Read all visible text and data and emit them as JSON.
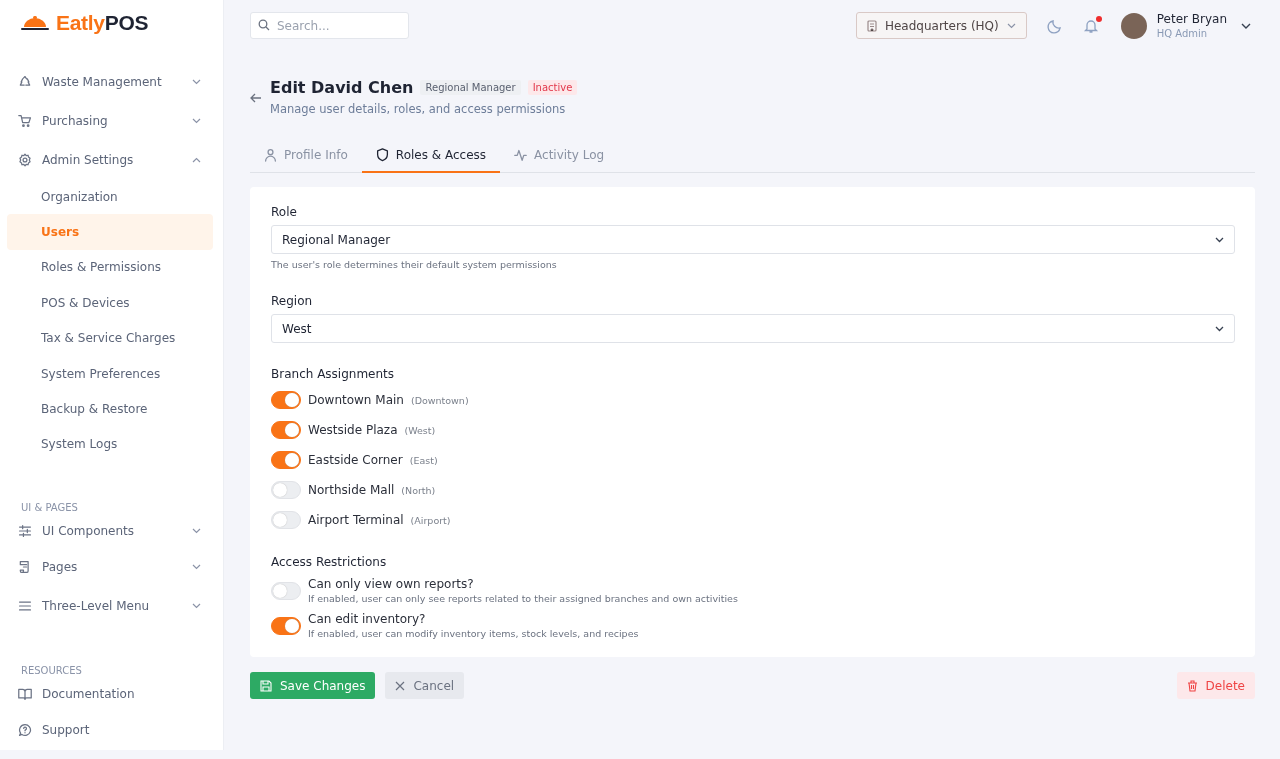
{
  "brand": {
    "name_a": "Eatly",
    "name_b": "POS"
  },
  "sidebar": {
    "items": [
      {
        "label": "Waste Management",
        "expanded": false
      },
      {
        "label": "Purchasing",
        "expanded": false
      },
      {
        "label": "Admin Settings",
        "expanded": true,
        "children": [
          {
            "label": "Organization",
            "selected": false
          },
          {
            "label": "Users",
            "selected": true
          },
          {
            "label": "Roles & Permissions",
            "selected": false
          },
          {
            "label": "POS & Devices",
            "selected": false
          },
          {
            "label": "Tax & Service Charges",
            "selected": false
          },
          {
            "label": "System Preferences",
            "selected": false
          },
          {
            "label": "Backup & Restore",
            "selected": false
          },
          {
            "label": "System Logs",
            "selected": false
          }
        ]
      }
    ],
    "sections": [
      {
        "title": "UI & PAGES",
        "items": [
          {
            "label": "UI Components",
            "expanded": false
          },
          {
            "label": "Pages",
            "expanded": false
          },
          {
            "label": "Three-Level Menu",
            "expanded": false
          }
        ]
      },
      {
        "title": "RESOURCES",
        "items": [
          {
            "label": "Documentation"
          },
          {
            "label": "Support"
          }
        ]
      }
    ]
  },
  "search": {
    "placeholder": "Search..."
  },
  "branch_selector": {
    "value": "Headquarters (HQ)"
  },
  "notifications": {
    "unread": true
  },
  "user": {
    "name": "Peter Bryan",
    "role": "HQ Admin"
  },
  "page": {
    "title": "Edit David Chen",
    "subtitle": "Manage user details, roles, and access permissions",
    "badges": [
      {
        "label": "Regional Manager",
        "kind": "role"
      },
      {
        "label": "Inactive",
        "kind": "status"
      }
    ]
  },
  "tabs": [
    {
      "label": "Profile Info",
      "selected": false
    },
    {
      "label": "Roles & Access",
      "selected": true
    },
    {
      "label": "Activity Log",
      "selected": false
    }
  ],
  "form": {
    "role": {
      "label": "Role",
      "value": "Regional Manager",
      "help": "The user's role determines their default system permissions"
    },
    "region": {
      "label": "Region",
      "value": "West"
    },
    "branches": {
      "title": "Branch Assignments",
      "items": [
        {
          "name": "Downtown Main",
          "region": "(Downtown)",
          "on": true
        },
        {
          "name": "Westside Plaza",
          "region": "(West)",
          "on": true
        },
        {
          "name": "Eastside Corner",
          "region": "(East)",
          "on": true
        },
        {
          "name": "Northside Mall",
          "region": "(North)",
          "on": false
        },
        {
          "name": "Airport Terminal",
          "region": "(Airport)",
          "on": false
        }
      ]
    },
    "restrictions": {
      "title": "Access Restrictions",
      "items": [
        {
          "label": "Can only view own reports?",
          "help": "If enabled, user can only see reports related to their assigned branches and own activities",
          "on": false
        },
        {
          "label": "Can edit inventory?",
          "help": "If enabled, user can modify inventory items, stock levels, and recipes",
          "on": true
        }
      ]
    }
  },
  "actions": {
    "save": "Save Changes",
    "cancel": "Cancel",
    "delete": "Delete"
  }
}
